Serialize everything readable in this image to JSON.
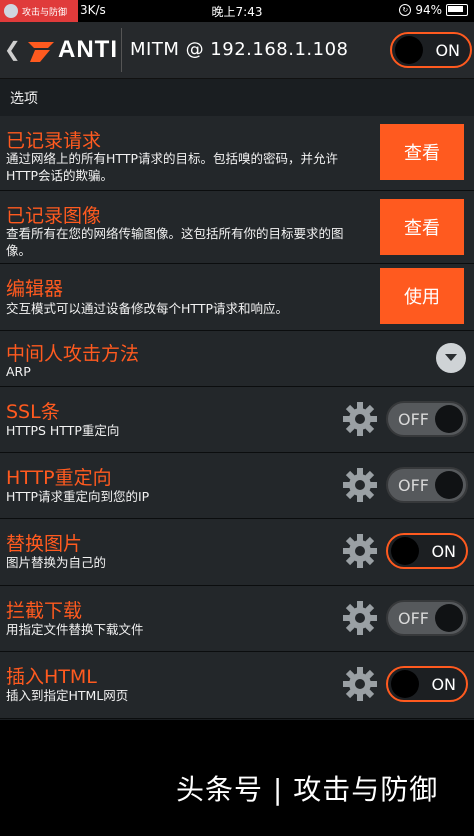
{
  "status_bar": {
    "notification": "攻击与防御",
    "speed": "3K/s",
    "time": "晚上7:43",
    "battery": "94%"
  },
  "header": {
    "back_icon": "chevron-left-icon",
    "app_name": "ANTI",
    "title": "MITM @ 192.168.1.108",
    "toggle_label": "ON"
  },
  "section_label": "选项",
  "rows": [
    {
      "title": "已记录请求",
      "desc": "通过网络上的所有HTTP请求的目标。包括嗅的密码，并允许HTTP会话的欺骗。",
      "button": "查看"
    },
    {
      "title": "已记录图像",
      "desc": "查看所有在您的网络传输图像。这包括所有你的目标要求的图像。",
      "button": "查看"
    },
    {
      "title": "编辑器",
      "desc": "交互模式可以通过设备修改每个HTTP请求和响应。",
      "button": "使用"
    },
    {
      "title": "中间人攻击方法",
      "desc": "ARP",
      "control": "dropdown"
    },
    {
      "title": "SSL条",
      "desc": "HTTPS HTTP重定向",
      "toggle": "OFF"
    },
    {
      "title": "HTTP重定向",
      "desc": "HTTP请求重定向到您的IP",
      "toggle": "OFF"
    },
    {
      "title": "替换图片",
      "desc": "图片替换为自己的",
      "toggle": "ON"
    },
    {
      "title": "拦截下载",
      "desc": "用指定文件替换下载文件",
      "toggle": "OFF"
    },
    {
      "title": "插入HTML",
      "desc": "插入到指定HTML网页",
      "toggle": "ON"
    }
  ],
  "watermark": "头条号 | 攻击与防御",
  "colors": {
    "accent": "#ff5a1f",
    "background": "#1a1e21",
    "row": "#23272a"
  }
}
